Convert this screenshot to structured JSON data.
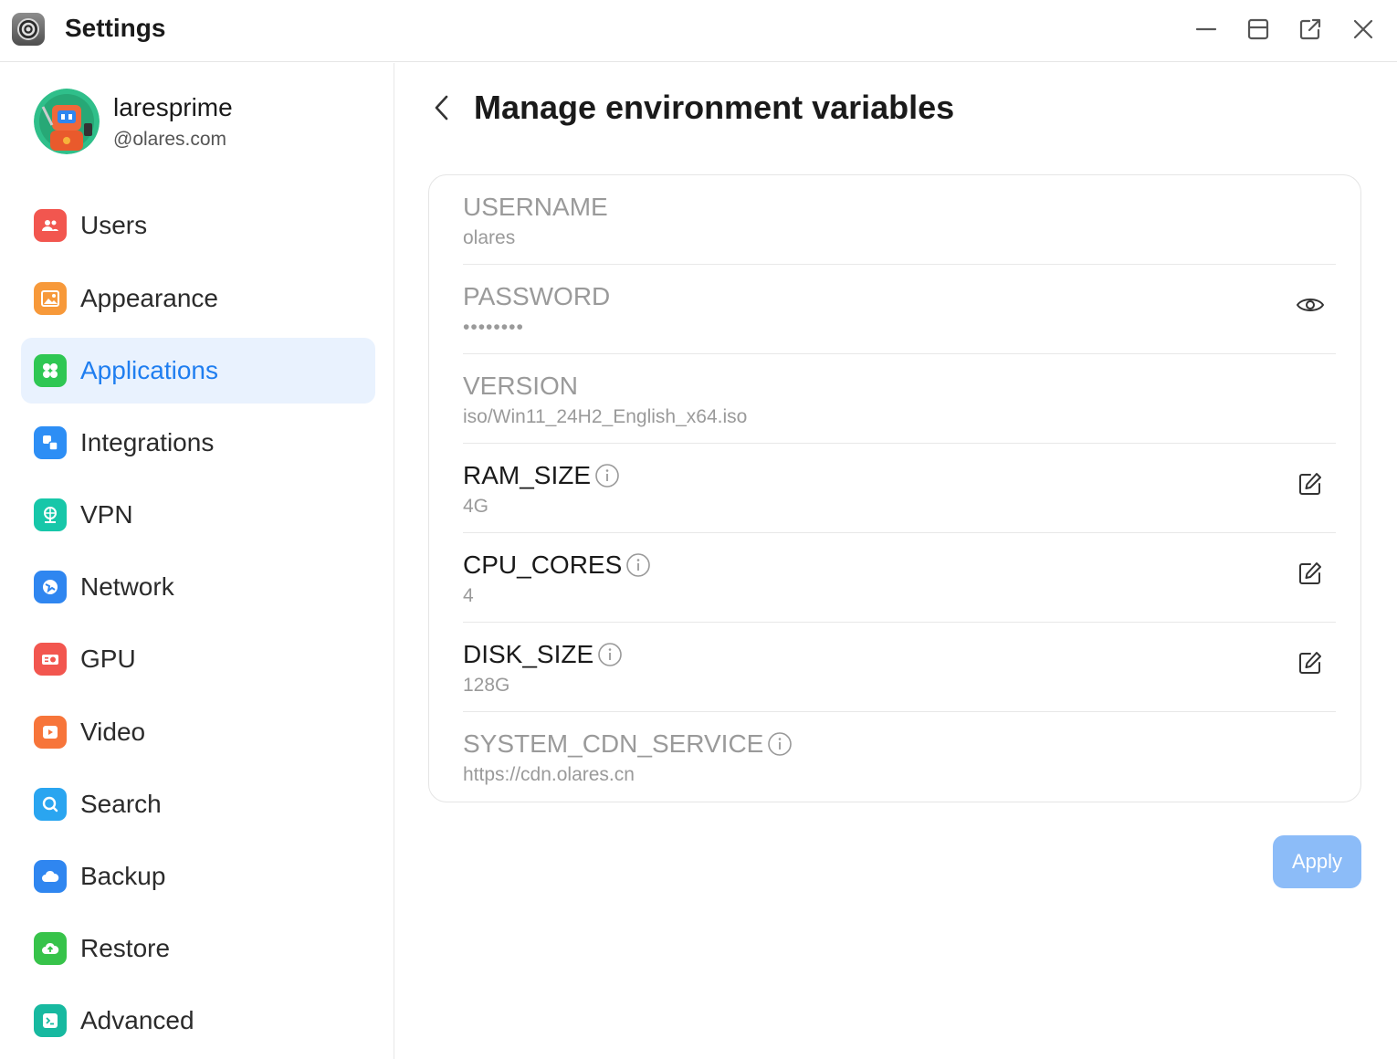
{
  "window": {
    "title": "Settings",
    "controls": [
      "minimize-icon",
      "maximize-icon",
      "popout-icon",
      "close-icon"
    ]
  },
  "user": {
    "name": "laresprime",
    "domain": "@olares.com"
  },
  "sidebar": {
    "items": [
      {
        "label": "Users",
        "icon": "users-icon",
        "color": "#f2564f",
        "active": false
      },
      {
        "label": "Appearance",
        "icon": "appearance-icon",
        "color": "#f7993a",
        "active": false
      },
      {
        "label": "Applications",
        "icon": "applications-icon",
        "color": "#2fc753",
        "active": true
      },
      {
        "label": "Integrations",
        "icon": "integrations-icon",
        "color": "#2d8ef5",
        "active": false
      },
      {
        "label": "VPN",
        "icon": "vpn-icon",
        "color": "#17c7a9",
        "active": false
      },
      {
        "label": "Network",
        "icon": "network-icon",
        "color": "#2f86f0",
        "active": false
      },
      {
        "label": "GPU",
        "icon": "gpu-icon",
        "color": "#f2564f",
        "active": false
      },
      {
        "label": "Video",
        "icon": "video-icon",
        "color": "#f7753a",
        "active": false
      },
      {
        "label": "Search",
        "icon": "search-icon",
        "color": "#2aa5f0",
        "active": false
      },
      {
        "label": "Backup",
        "icon": "backup-icon",
        "color": "#2f86f0",
        "active": false
      },
      {
        "label": "Restore",
        "icon": "restore-icon",
        "color": "#37c34a",
        "active": false
      },
      {
        "label": "Advanced",
        "icon": "advanced-icon",
        "color": "#17b9a0",
        "active": false
      }
    ]
  },
  "main": {
    "title": "Manage environment variables",
    "variables": [
      {
        "key": "USERNAME",
        "value": "olares",
        "editable": false,
        "info": false,
        "action": null
      },
      {
        "key": "PASSWORD",
        "value": "••••••••",
        "editable": false,
        "info": false,
        "action": "eye-icon"
      },
      {
        "key": "VERSION",
        "value": "iso/Win11_24H2_English_x64.iso",
        "editable": false,
        "info": false,
        "action": null
      },
      {
        "key": "RAM_SIZE",
        "value": "4G",
        "editable": true,
        "info": true,
        "action": "edit-icon"
      },
      {
        "key": "CPU_CORES",
        "value": "4",
        "editable": true,
        "info": true,
        "action": "edit-icon"
      },
      {
        "key": "DISK_SIZE",
        "value": "128G",
        "editable": true,
        "info": true,
        "action": "edit-icon"
      },
      {
        "key": "SYSTEM_CDN_SERVICE",
        "value": "https://cdn.olares.cn",
        "editable": false,
        "info": true,
        "action": null
      }
    ],
    "apply_label": "Apply"
  },
  "colors": {
    "accent": "#1f7ef0",
    "active_bg": "#e9f2fe",
    "apply_bg": "#8cbcf8",
    "muted_text": "#9a9a9a"
  }
}
